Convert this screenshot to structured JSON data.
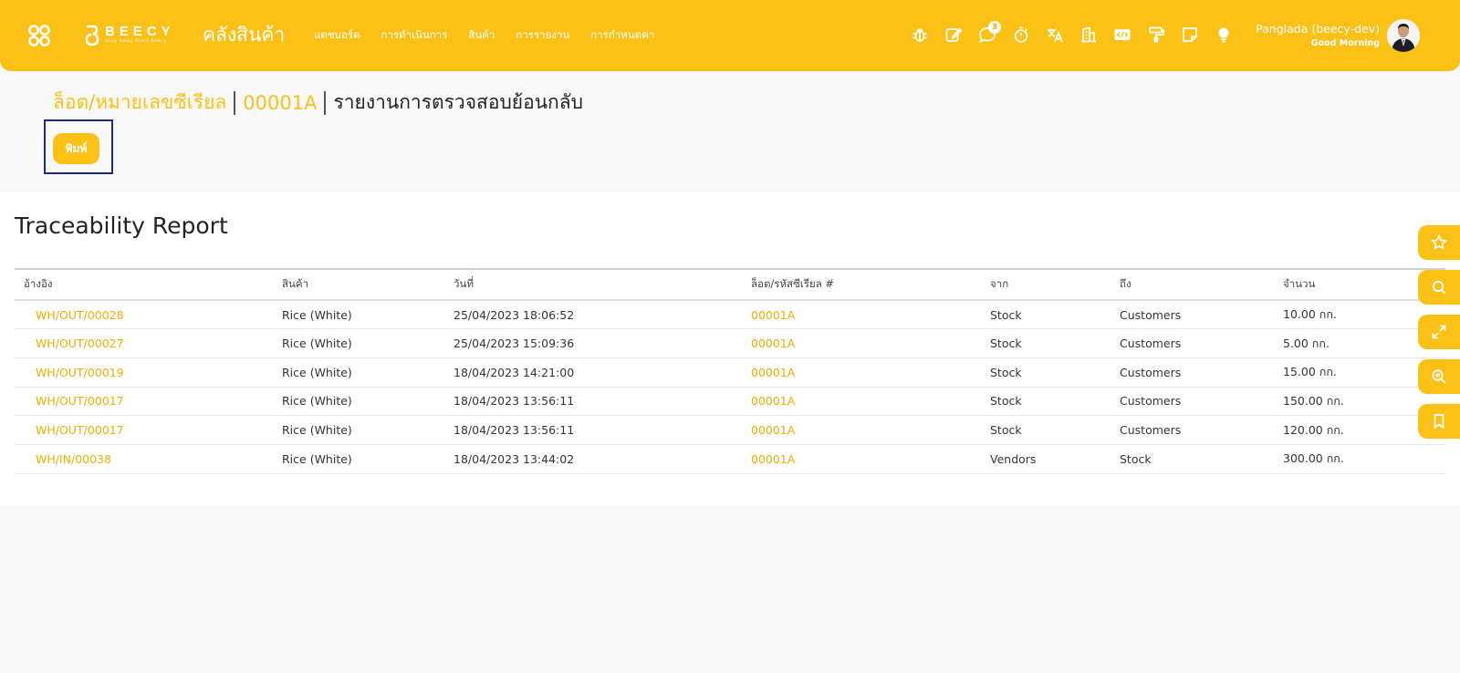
{
  "navbar": {
    "brand": {
      "name": "BEECY",
      "tagline": "Step Away Start Beecy"
    },
    "app_title": "คลังสินค้า",
    "menu": [
      "แดชบอร์ด",
      "การดำเนินการ",
      "สินค้า",
      "การรายงาน",
      "การกำหนดค่า"
    ],
    "icons": [
      "bug-icon",
      "edit-icon",
      "chat-icon",
      "stopwatch-icon",
      "translate-icon",
      "building-icon",
      "code-icon",
      "paint-roller-icon",
      "note-icon",
      "lightbulb-icon"
    ],
    "chat_badge": "3",
    "user": {
      "name": "Panglada (beecy-dev)",
      "greeting": "Good Morning"
    }
  },
  "breadcrumb": {
    "parent": "ล็อต/หมายเลขซีเรียล",
    "record": "00001A",
    "current": "รายงานการตรวจสอบย้อนกลับ"
  },
  "actions": {
    "print_label": "พิมพ์"
  },
  "report": {
    "title": "Traceability Report",
    "columns": [
      "อ้างอิง",
      "สินค้า",
      "วันที่",
      "ล็อต/รหัสซีเรียล #",
      "จาก",
      "ถึง",
      "จำนวน"
    ],
    "rows": [
      {
        "ref": "WH/OUT/00028",
        "product": "Rice (White)",
        "date": "25/04/2023 18:06:52",
        "lot": "00001A",
        "from": "Stock",
        "to": "Customers",
        "qty": "10.00 กก."
      },
      {
        "ref": "WH/OUT/00027",
        "product": "Rice (White)",
        "date": "25/04/2023 15:09:36",
        "lot": "00001A",
        "from": "Stock",
        "to": "Customers",
        "qty": "5.00 กก."
      },
      {
        "ref": "WH/OUT/00019",
        "product": "Rice (White)",
        "date": "18/04/2023 14:21:00",
        "lot": "00001A",
        "from": "Stock",
        "to": "Customers",
        "qty": "15.00 กก."
      },
      {
        "ref": "WH/OUT/00017",
        "product": "Rice (White)",
        "date": "18/04/2023 13:56:11",
        "lot": "00001A",
        "from": "Stock",
        "to": "Customers",
        "qty": "150.00 กก."
      },
      {
        "ref": "WH/OUT/00017",
        "product": "Rice (White)",
        "date": "18/04/2023 13:56:11",
        "lot": "00001A",
        "from": "Stock",
        "to": "Customers",
        "qty": "120.00 กก."
      },
      {
        "ref": "WH/IN/00038",
        "product": "Rice (White)",
        "date": "18/04/2023 13:44:02",
        "lot": "00001A",
        "from": "Vendors",
        "to": "Stock",
        "qty": "300.00 กก."
      }
    ]
  },
  "float_bar": [
    "star-icon",
    "search-icon",
    "expand-icon",
    "zoom-in-icon",
    "bookmark-icon"
  ],
  "colors": {
    "brand": "#fbc117",
    "link": "#f0ad00",
    "focus_outline": "#1d2a7e"
  }
}
